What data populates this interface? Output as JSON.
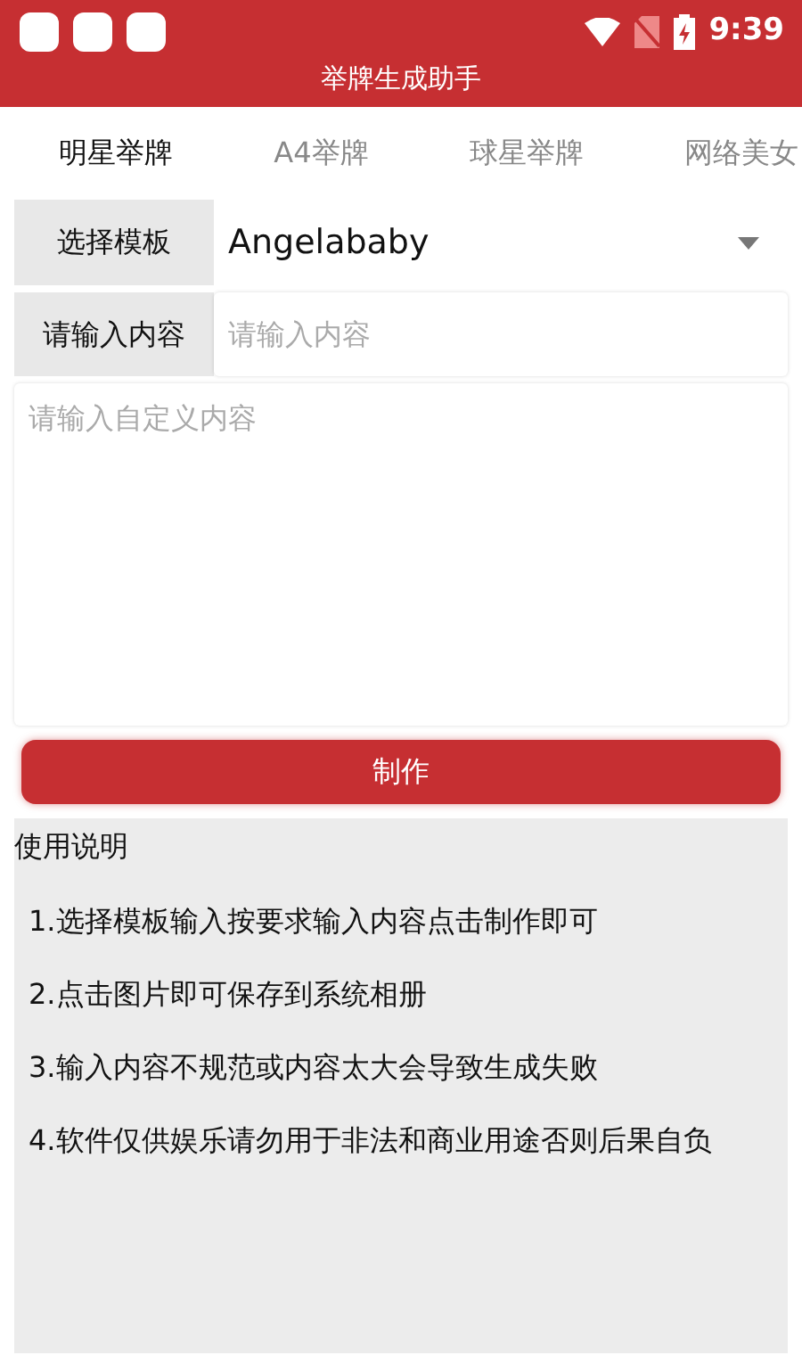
{
  "status_bar": {
    "time": "9:39"
  },
  "app_bar": {
    "title": "举牌生成助手"
  },
  "tabs": [
    {
      "label": "明星举牌",
      "selected": true
    },
    {
      "label": "A4举牌",
      "selected": false
    },
    {
      "label": "球星举牌",
      "selected": false
    },
    {
      "label": "网络美女",
      "selected": false
    }
  ],
  "template": {
    "label": "选择模板",
    "value": "Angelababy"
  },
  "content": {
    "label": "请输入内容",
    "placeholder": "请输入内容"
  },
  "custom": {
    "placeholder": "请输入自定义内容"
  },
  "make_button": "制作",
  "instructions": {
    "title": "使用说明",
    "items": [
      "1.选择模板输入按要求输入内容点击制作即可",
      "2.点击图片即可保存到系统相册",
      "3.输入内容不规范或内容太大会导致生成失败",
      "4.软件仅供娱乐请勿用于非法和商业用途否则后果自负"
    ]
  }
}
